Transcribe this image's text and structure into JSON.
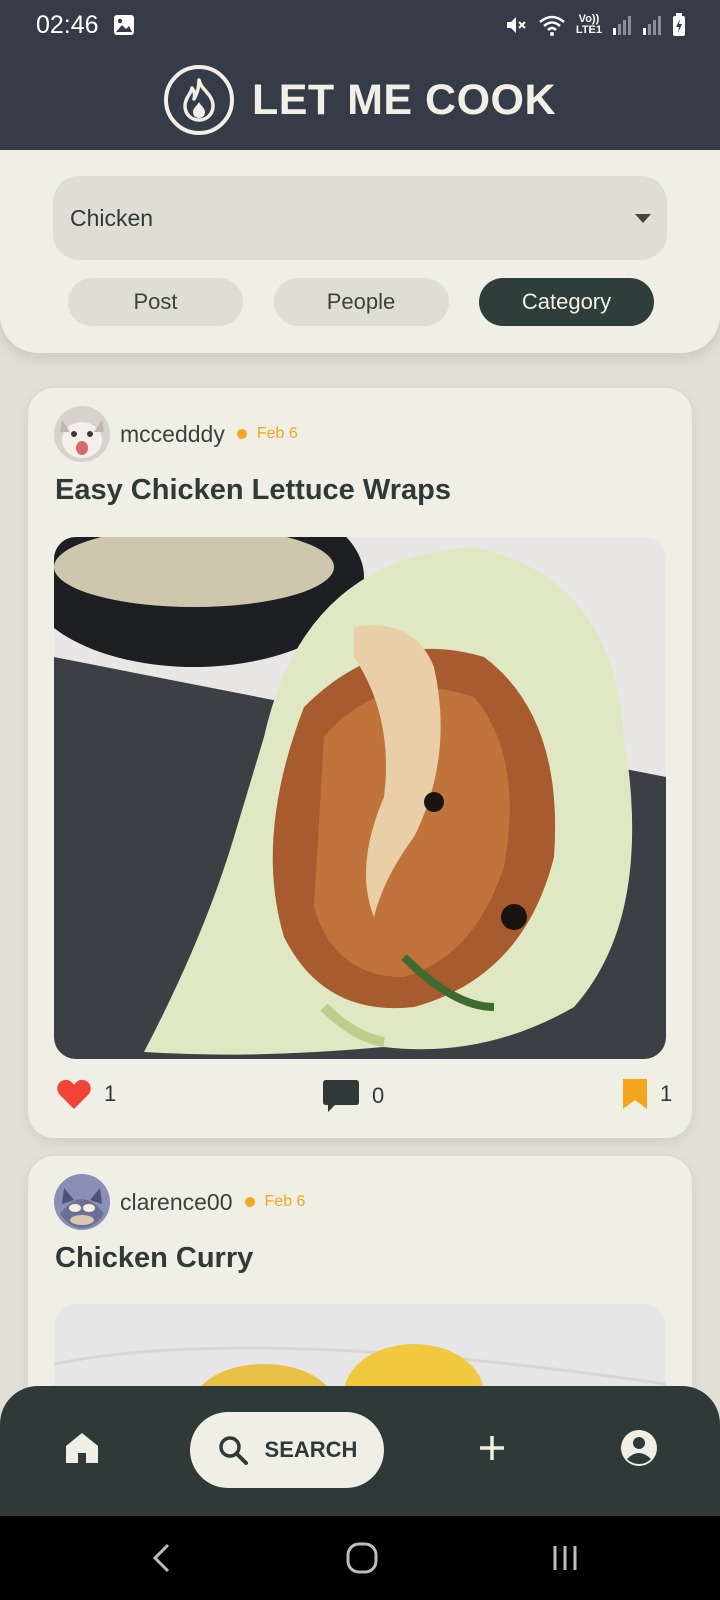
{
  "status_bar": {
    "time": "02:46",
    "gallery_icon": "image-icon",
    "icons": [
      "mute-icon",
      "wifi-icon",
      "volte-lte-icon",
      "signal-icon",
      "signal-icon",
      "battery-charging-icon"
    ],
    "volte_top": "Vo))",
    "volte_bottom": "LTE1"
  },
  "header": {
    "title": "LET ME COOK",
    "logo_icon": "flame-icon",
    "background": "#363c47"
  },
  "search": {
    "selected_category": "Chicken",
    "filters": [
      {
        "label": "Post",
        "active": false
      },
      {
        "label": "People",
        "active": false
      },
      {
        "label": "Category",
        "active": true
      }
    ]
  },
  "posts": [
    {
      "username": "mccedddy",
      "date": "Feb 6",
      "title": "Easy Chicken Lettuce Wraps",
      "likes": "1",
      "comments": "0",
      "saves": "1"
    },
    {
      "username": "clarence00",
      "date": "Feb 6",
      "title": "Chicken Curry"
    }
  ],
  "bottom_nav": {
    "search_label": "SEARCH",
    "items": [
      "home-icon",
      "search-icon",
      "add-icon",
      "profile-icon"
    ]
  },
  "colors": {
    "accent": "#f5a51c",
    "like": "#f04438",
    "dark": "#2f3a38",
    "surface": "#f0efe5"
  }
}
